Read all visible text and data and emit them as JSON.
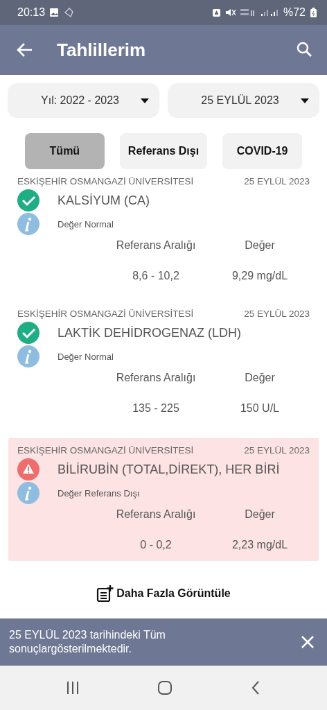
{
  "status_bar": {
    "time": "20:13",
    "battery": "%72"
  },
  "app_bar": {
    "title": "Tahlillerim"
  },
  "filters": [
    {
      "label": "Yıl: 2022 - 2023"
    },
    {
      "label": "25 EYLÜL 2023"
    }
  ],
  "tabs": [
    {
      "label": "Tümü",
      "selected": true
    },
    {
      "label": "Referans Dışı",
      "selected": false
    },
    {
      "label": "COVID-19",
      "selected": false
    }
  ],
  "results": [
    {
      "kind": "normal",
      "institution": "ESKİŞEHİR OSMANGAZİ ÜNİVERSİTESİ",
      "date": "25 EYLÜL 2023",
      "name": "KALSİYUM (CA)",
      "status": "Değer Normal",
      "range_label": "Referans Aralığı",
      "value_label": "Değer",
      "range": "8,6 - 10,2",
      "value": "9,29 mg/dL"
    },
    {
      "kind": "normal",
      "institution": "ESKİŞEHİR OSMANGAZİ ÜNİVERSİTESİ",
      "date": "25 EYLÜL 2023",
      "name": "LAKTİK DEHİDROGENAZ (LDH)",
      "status": "Değer Normal",
      "range_label": "Referans Aralığı",
      "value_label": "Değer",
      "range": "135 - 225",
      "value": "150 U/L"
    },
    {
      "kind": "abnormal",
      "institution": "ESKİŞEHİR OSMANGAZİ ÜNİVERSİTESİ",
      "date": "25 EYLÜL 2023",
      "name": "BİLİRUBİN (TOTAL,DİREKT), HER BİRİ",
      "status": "Değer Referans Dışı",
      "range_label": "Referans Aralığı",
      "value_label": "Değer",
      "range": "0 - 0,2",
      "value": "2,23 mg/dL"
    }
  ],
  "more_button": {
    "label": "Daha Fazla Görüntüle"
  },
  "snackbar": {
    "text": "25 EYLÜL 2023 tarihindeki Tüm sonuçlargösterilmektedir."
  }
}
